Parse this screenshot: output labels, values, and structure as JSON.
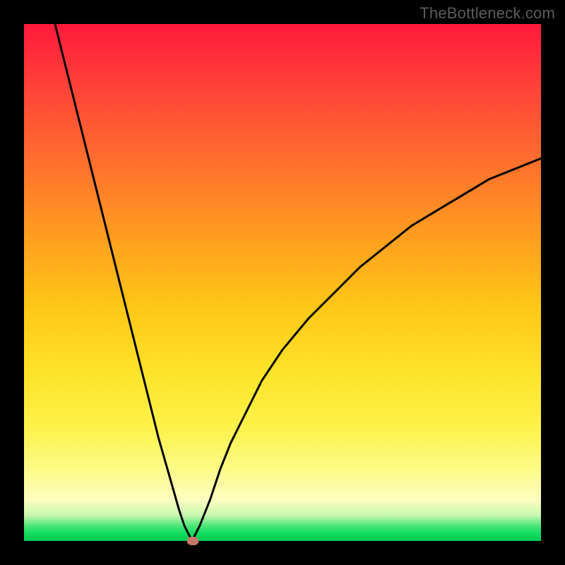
{
  "watermark": "TheBottleneck.com",
  "colors": {
    "frame": "#000000",
    "gradient_top": "#ff1a3a",
    "gradient_bottom": "#00c853",
    "curve": "#000000",
    "marker": "#c9766b",
    "watermark_text": "#5b5b5b"
  },
  "chart_data": {
    "type": "line",
    "title": "",
    "xlabel": "",
    "ylabel": "",
    "xlim": [
      0,
      100
    ],
    "ylim": [
      0,
      100
    ],
    "grid": false,
    "legend": false,
    "x": [
      6,
      8,
      10,
      12,
      14,
      16,
      18,
      20,
      22,
      24,
      26,
      28,
      30,
      31,
      32,
      32.6,
      33,
      34,
      36,
      38,
      40,
      43,
      46,
      50,
      55,
      60,
      65,
      70,
      75,
      80,
      85,
      90,
      95,
      100
    ],
    "y": [
      100,
      92,
      84,
      76,
      68,
      60,
      52,
      44,
      36,
      28,
      20,
      13,
      6,
      3,
      1,
      0,
      1,
      3,
      8,
      14,
      19,
      25,
      31,
      37,
      43,
      48,
      53,
      57,
      61,
      64,
      67,
      70,
      72,
      74
    ],
    "marker": {
      "x": 32.6,
      "y": 0
    },
    "notes": "V-shaped bottleneck curve; minimum (optimal match) near x≈32.6. Values estimated from pixel positions; no axis ticks or labels visible."
  }
}
